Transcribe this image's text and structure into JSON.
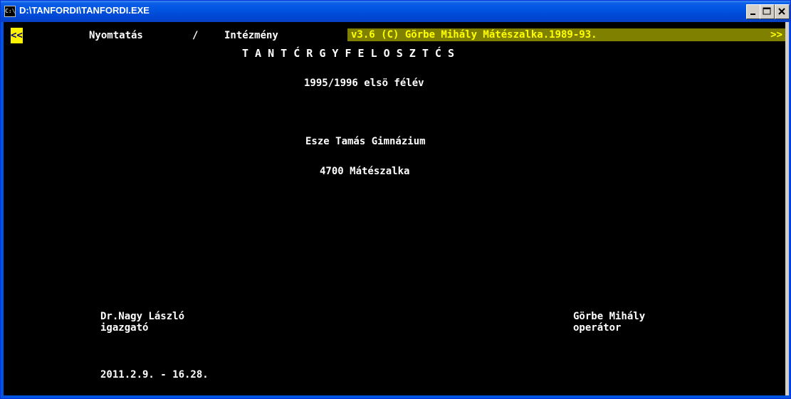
{
  "window": {
    "title": "D:\\TANFORDI\\TANFORDI.EXE",
    "icon_label": "C:\\",
    "icon_name": "console-window-icon",
    "controls": [
      "minimize-icon",
      "maximize-icon",
      "close-icon"
    ]
  },
  "menu": {
    "back_label": "<<",
    "item1": "Nyomtatás",
    "separator": "/",
    "item2": "Intézmény",
    "version_label": "v3.6 (C) Görbe Mihály Mátészalka.1989-93.",
    "forward_label": ">>"
  },
  "report": {
    "title": "T A N T Ć R G Y F E L O S Z T Ć S",
    "semester": "1995/1996 elsö félév",
    "institution": "Esze Tamás Gimnázium",
    "city": "4700 Mátészalka",
    "principal_name": "Dr.Nagy László",
    "principal_role": "igazgató",
    "operator_name": "Görbe Mihály",
    "operator_role": "operátor",
    "datetime": "2011.2.9. - 16.28."
  },
  "colors": {
    "console_bg": "#000000",
    "text": "#ffffff",
    "highlight_bg": "#fff200",
    "version_bg": "#808000",
    "version_text": "#ffff00",
    "titlebar": "#0054e3"
  }
}
